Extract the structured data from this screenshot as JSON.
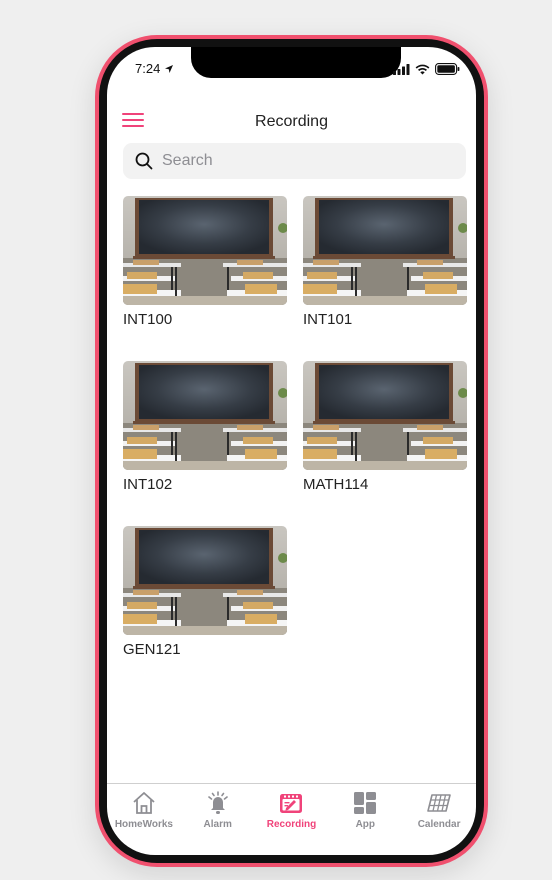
{
  "status_bar": {
    "time": "7:24"
  },
  "header": {
    "title": "Recording"
  },
  "search": {
    "placeholder": "Search"
  },
  "recordings": [
    {
      "label": "INT100"
    },
    {
      "label": "INT101"
    },
    {
      "label": "INT102"
    },
    {
      "label": "MATH114"
    },
    {
      "label": "GEN121"
    }
  ],
  "tabbar": {
    "items": [
      {
        "label": "HomeWorks",
        "icon": "home-icon"
      },
      {
        "label": "Alarm",
        "icon": "alarm-bell-icon"
      },
      {
        "label": "Recording",
        "icon": "recording-icon",
        "active": true
      },
      {
        "label": "App",
        "icon": "app-grid-icon"
      },
      {
        "label": "Calendar",
        "icon": "calendar-icon"
      }
    ]
  },
  "colors": {
    "accent": "#f0437a",
    "phone_frame": "#f0506e",
    "inactive": "#8e8e93"
  }
}
